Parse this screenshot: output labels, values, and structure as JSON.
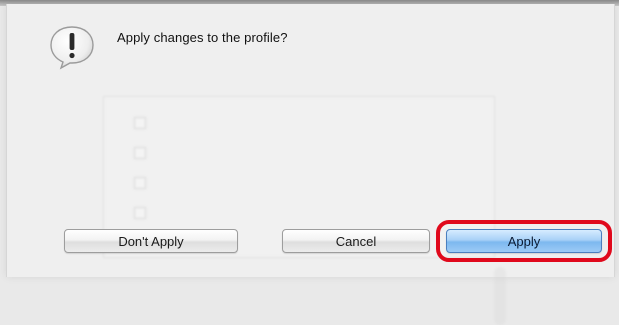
{
  "dialog": {
    "message": "Apply changes to the profile?",
    "icon": "alert-icon"
  },
  "buttons": {
    "dont_apply": "Don't Apply",
    "cancel": "Cancel",
    "apply": "Apply"
  },
  "colors": {
    "highlight": "#e0091c",
    "default_button": "#7db8ef"
  }
}
